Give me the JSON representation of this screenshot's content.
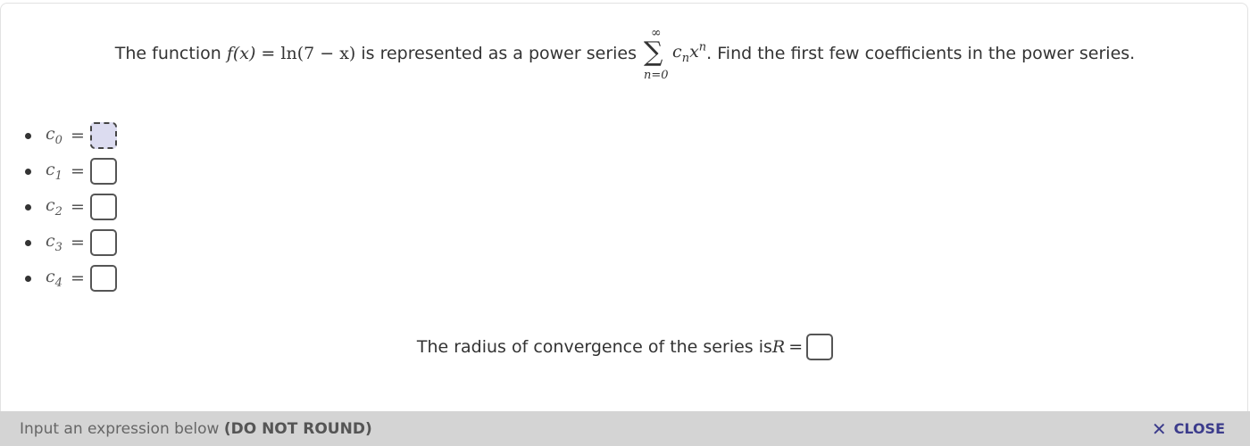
{
  "question": {
    "prefix": "The function ",
    "f_label": "f(x)",
    "eq": " = ",
    "expression": "ln(7 − x)",
    "middle": " is represented as a power series ",
    "sum_top": "∞",
    "sum_bottom": "n=0",
    "term": "c",
    "term_sub": "n",
    "term_var": "x",
    "term_sup": "n",
    "suffix": ". Find the first few coefficients in the power series."
  },
  "coefficients": [
    {
      "label": "c",
      "sub": "0",
      "eq": "=",
      "value": ""
    },
    {
      "label": "c",
      "sub": "1",
      "eq": "=",
      "value": ""
    },
    {
      "label": "c",
      "sub": "2",
      "eq": "=",
      "value": ""
    },
    {
      "label": "c",
      "sub": "3",
      "eq": "=",
      "value": ""
    },
    {
      "label": "c",
      "sub": "4",
      "eq": "=",
      "value": ""
    }
  ],
  "radius": {
    "text": "The radius of convergence of the series is ",
    "var": "R",
    "eq": "=",
    "value": ""
  },
  "bottom_bar": {
    "hint": "Input an expression below ",
    "hint_bold": "(DO NOT ROUND)",
    "close_label": "CLOSE",
    "close_icon": "close-icon"
  },
  "colors": {
    "active_input_bg": "#dcdcf0",
    "bottom_bar_bg": "#d4d4d4",
    "close_color": "#3c3c8c"
  }
}
